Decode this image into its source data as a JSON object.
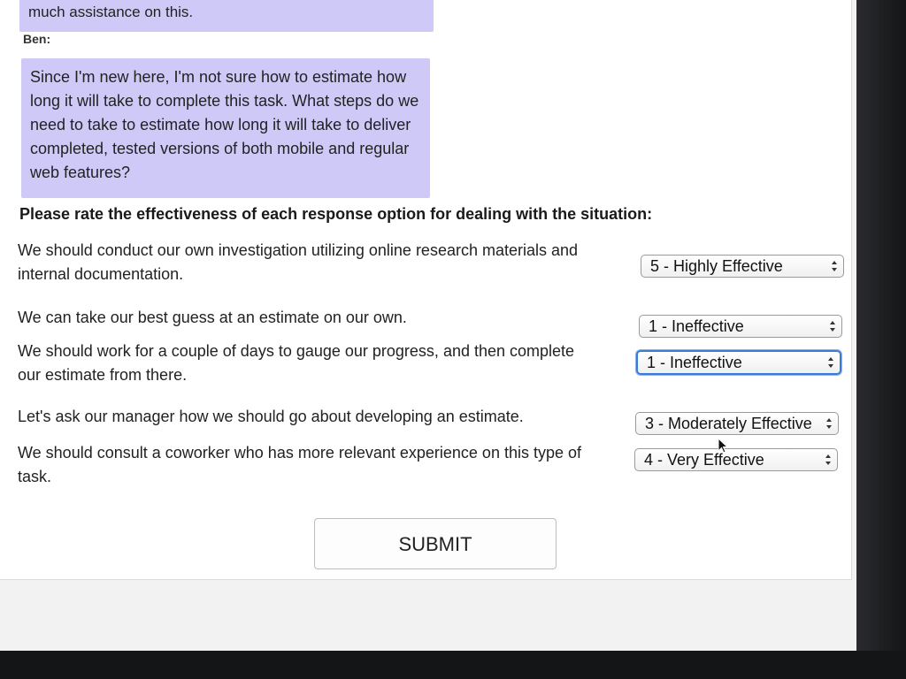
{
  "conversation": {
    "previous_message_tail": "much assistance on this.",
    "speaker": "Ben:",
    "message": "Since I'm new here, I'm not sure how to estimate how long it will take to complete this task. What steps do we need to take to estimate how long it will take to deliver completed, tested versions of both mobile and regular web features?"
  },
  "instruction": "Please rate the effectiveness of each response option for dealing with the situation:",
  "options": [
    {
      "text": "We should conduct our own investigation utilizing online research materials and internal documentation.",
      "rating": "5 - Highly Effective"
    },
    {
      "text": "We can take our best guess at an estimate on our own.",
      "rating": "1 - Ineffective"
    },
    {
      "text": "We should work for a couple of days to gauge our progress, and then complete our estimate from there.",
      "rating": "1 - Ineffective"
    },
    {
      "text": "Let's ask our manager how we should go about developing an estimate.",
      "rating": "3 - Moderately Effective"
    },
    {
      "text": "We should consult a coworker who has more relevant experience on this type of task.",
      "rating": "4 - Very Effective"
    }
  ],
  "submit_label": "SUBMIT",
  "colors": {
    "bubble": "#cfc9f7",
    "focus_ring": "#3a7bd5"
  }
}
